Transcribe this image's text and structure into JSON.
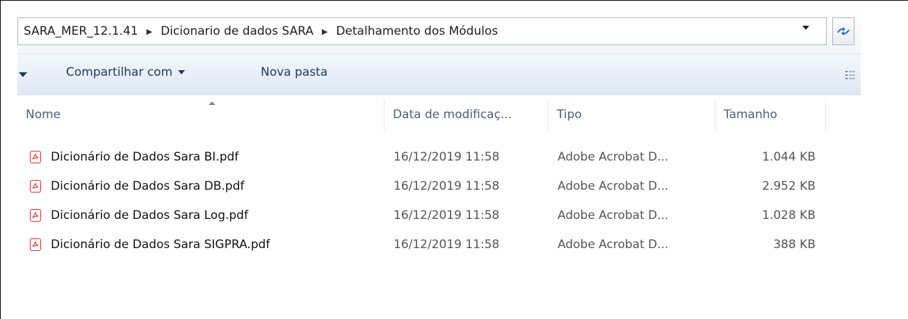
{
  "address_bar": {
    "crumbs": [
      "SARA_MER_12.1.41",
      "Dicionario de dados SARA",
      "Detalhamento dos Módulos"
    ]
  },
  "toolbar": {
    "share_label": "Compartilhar com",
    "new_folder_label": "Nova pasta"
  },
  "columns": {
    "name": "Nome",
    "date": "Data de modificaç...",
    "type": "Tipo",
    "size": "Tamanho"
  },
  "files": [
    {
      "name": "Dicionário de Dados Sara BI.pdf",
      "date": "16/12/2019 11:58",
      "type": "Adobe Acrobat D...",
      "size": "1.044 KB"
    },
    {
      "name": "Dicionário de Dados Sara DB.pdf",
      "date": "16/12/2019 11:58",
      "type": "Adobe Acrobat D...",
      "size": "2.952 KB"
    },
    {
      "name": "Dicionário de Dados Sara Log.pdf",
      "date": "16/12/2019 11:58",
      "type": "Adobe Acrobat D...",
      "size": "1.028 KB"
    },
    {
      "name": "Dicionário de Dados Sara SIGPRA.pdf",
      "date": "16/12/2019 11:58",
      "type": "Adobe Acrobat D...",
      "size": "388 KB"
    }
  ],
  "icons": {
    "file": "pdf-file-icon",
    "refresh": "refresh-icon",
    "view": "view-options-icon",
    "breadcrumb_separator": "chevron-right-icon"
  },
  "colors": {
    "toolbar_text": "#1e395b",
    "pdf_red": "#d22f2f",
    "header_text": "#4c607a"
  }
}
